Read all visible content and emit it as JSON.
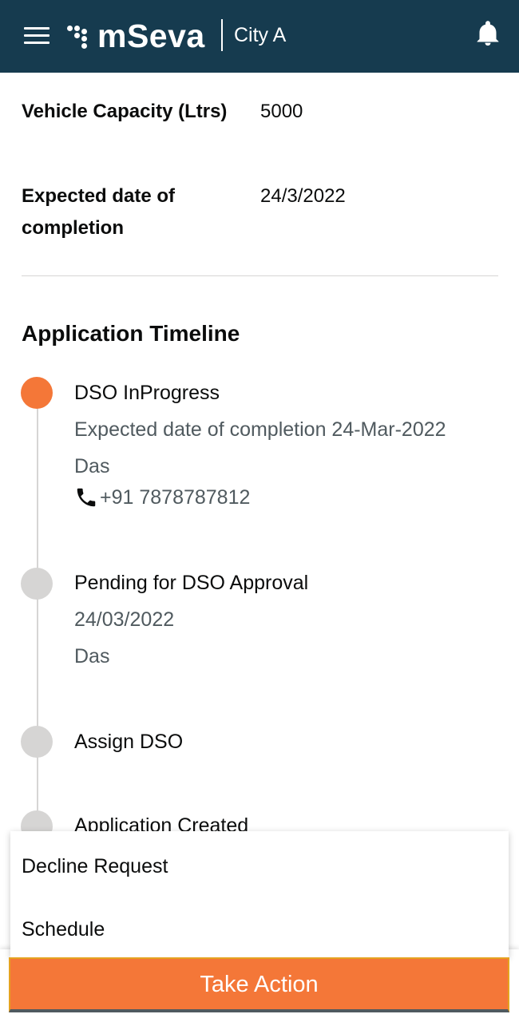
{
  "header": {
    "app_name": "mSeva",
    "city": "City A",
    "menu_icon": "hamburger-menu-icon",
    "notification_icon": "bell-icon",
    "colors": {
      "background": "#163b4f",
      "text": "#ffffff"
    }
  },
  "details": [
    {
      "label": "Vehicle Capacity (Ltrs)",
      "value": "5000"
    },
    {
      "label": "Expected date of completion",
      "value": "24/3/2022"
    }
  ],
  "timeline": {
    "title": "Application Timeline",
    "items": [
      {
        "status": "DSO InProgress",
        "detail": "Expected date of completion 24-Mar-2022",
        "assignee": "Das",
        "phone": "+91 7878787812",
        "active": true
      },
      {
        "status": "Pending for DSO Approval",
        "date": "24/03/2022",
        "assignee": "Das",
        "active": false
      },
      {
        "status": "Assign DSO",
        "active": false
      },
      {
        "status": "Application Created",
        "active": false
      }
    ],
    "colors": {
      "active": "#f47738",
      "inactive": "#d6d5d4"
    }
  },
  "action_menu": {
    "items": [
      "Decline Request",
      "Schedule"
    ]
  },
  "footer": {
    "take_action_label": "Take Action",
    "colors": {
      "button": "#f47738"
    }
  }
}
